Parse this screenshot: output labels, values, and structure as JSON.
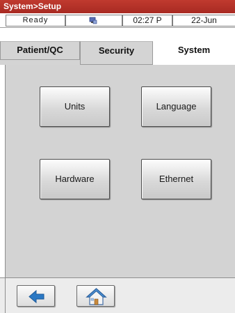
{
  "window": {
    "title": "System>Setup"
  },
  "status": {
    "ready": "Ready",
    "network_icon": "network-icon",
    "time": "02:27 P",
    "date": "22-Jun"
  },
  "tabs": [
    {
      "label": "Patient/QC",
      "active": false
    },
    {
      "label": "Security",
      "active": false
    },
    {
      "label": "System",
      "active": true
    }
  ],
  "buttons": {
    "units": "Units",
    "language": "Language",
    "hardware": "Hardware",
    "ethernet": "Ethernet"
  },
  "nav": {
    "back_icon": "back-arrow-icon",
    "home_icon": "home-icon"
  },
  "colors": {
    "title_bar": "#b2302a",
    "panel": "#d3d3d3",
    "back_arrow": "#2a78c4"
  }
}
